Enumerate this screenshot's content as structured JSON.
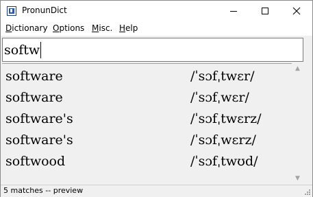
{
  "window": {
    "title": "PronunDict",
    "icon": "pronundict-app-icon"
  },
  "menu": {
    "items": [
      {
        "accel": "D",
        "rest": "ictionary"
      },
      {
        "accel": "O",
        "rest": "ptions"
      },
      {
        "accel": "M",
        "rest": "isc."
      },
      {
        "accel": "H",
        "rest": "elp"
      }
    ]
  },
  "search": {
    "value": "softw"
  },
  "results": [
    {
      "word": "software",
      "pron": "/ˈsɔfˌtwɛr/"
    },
    {
      "word": "software",
      "pron": "/ˈsɔfˌwɛr/"
    },
    {
      "word": "software's",
      "pron": "/ˈsɔfˌtwɛrz/"
    },
    {
      "word": "software's",
      "pron": "/ˈsɔfˌwɛrz/"
    },
    {
      "word": "softwood",
      "pron": "/ˈsɔfˌtwʊd/"
    }
  ],
  "status": {
    "text": "5 matches -- preview"
  },
  "icons": {
    "minimize": "minimize-icon",
    "maximize": "maximize-icon",
    "close": "close-icon",
    "scroll_up": "scroll-up-arrow-icon",
    "scroll_down": "scroll-down-arrow-icon"
  },
  "colors": {
    "chrome": "#f0f0f0",
    "titlebar": "#ffffff",
    "text": "#000000",
    "disabled_arrow": "#a3a3a3"
  }
}
